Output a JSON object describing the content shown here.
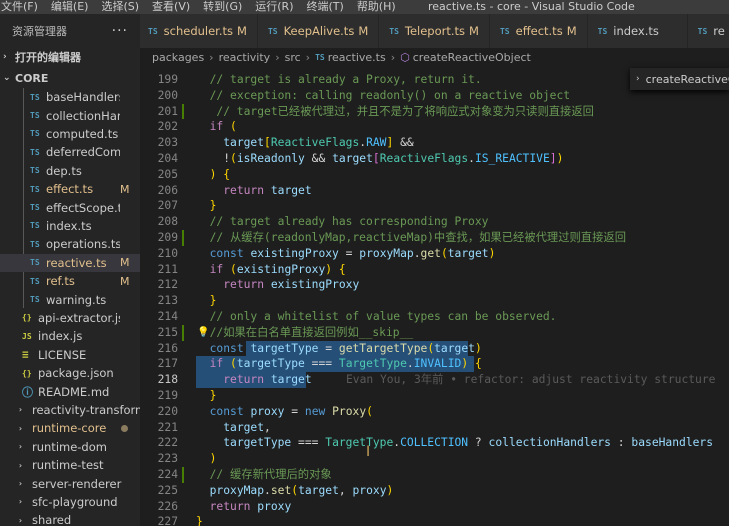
{
  "menu": [
    "文件(F)",
    "编辑(E)",
    "选择(S)",
    "查看(V)",
    "转到(G)",
    "运行(R)",
    "终端(T)",
    "帮助(H)"
  ],
  "window_title": "reactive.ts - core - Visual Studio Code",
  "sidebar": {
    "header": "资源管理器",
    "more": "···",
    "open_editors": "打开的编辑器",
    "root": "CORE",
    "files": [
      {
        "icon": "TS",
        "name": "baseHandlers.ts",
        "badge": ""
      },
      {
        "icon": "TS",
        "name": "collectionHandler...",
        "badge": ""
      },
      {
        "icon": "TS",
        "name": "computed.ts",
        "badge": ""
      },
      {
        "icon": "TS",
        "name": "deferredCompute...",
        "badge": ""
      },
      {
        "icon": "TS",
        "name": "dep.ts",
        "badge": ""
      },
      {
        "icon": "TS",
        "name": "effect.ts",
        "badge": "M"
      },
      {
        "icon": "TS",
        "name": "effectScope.ts",
        "badge": ""
      },
      {
        "icon": "TS",
        "name": "index.ts",
        "badge": ""
      },
      {
        "icon": "TS",
        "name": "operations.ts",
        "badge": ""
      },
      {
        "icon": "TS",
        "name": "reactive.ts",
        "badge": "M"
      },
      {
        "icon": "TS",
        "name": "ref.ts",
        "badge": "M"
      },
      {
        "icon": "TS",
        "name": "warning.ts",
        "badge": ""
      },
      {
        "icon": "{}",
        "name": "api-extractor.json",
        "badge": ""
      },
      {
        "icon": "JS",
        "name": "index.js",
        "badge": ""
      },
      {
        "icon": "≡",
        "name": "LICENSE",
        "badge": ""
      },
      {
        "icon": "{}",
        "name": "package.json",
        "badge": ""
      },
      {
        "icon": "ⓘ",
        "name": "README.md",
        "badge": ""
      }
    ],
    "folders": [
      "reactivity-transform",
      "runtime-core",
      "runtime-dom",
      "runtime-test",
      "server-renderer",
      "sfc-playground",
      "shared"
    ]
  },
  "tabs": [
    {
      "icon": "TS",
      "label": "scheduler.ts",
      "badge": "M"
    },
    {
      "icon": "TS",
      "label": "KeepAlive.ts",
      "badge": "M"
    },
    {
      "icon": "TS",
      "label": "Teleport.ts",
      "badge": "M"
    },
    {
      "icon": "TS",
      "label": "effect.ts",
      "badge": "M"
    },
    {
      "icon": "TS",
      "label": "index.ts",
      "badge": ""
    },
    {
      "icon": "TS",
      "label": "re",
      "badge": ""
    }
  ],
  "breadcrumb": [
    "packages",
    "reactivity",
    "src",
    "reactive.ts",
    "createReactiveObject"
  ],
  "sticky_scroll": "createReactiveOb",
  "code_lines": [
    {
      "n": "199",
      "text": "  // target is already a Proxy, return it."
    },
    {
      "n": "200",
      "text": "  // exception: calling readonly() on a reactive object"
    },
    {
      "n": "201",
      "text": "   // target已经被代理过，并且不是为了将响应式对象变为只读则直接返回"
    },
    {
      "n": "202",
      "text": "  if ("
    },
    {
      "n": "203",
      "text": "    target[ReactiveFlags.RAW] &&"
    },
    {
      "n": "204",
      "text": "    !(isReadonly && target[ReactiveFlags.IS_REACTIVE])"
    },
    {
      "n": "205",
      "text": "  ) {"
    },
    {
      "n": "206",
      "text": "    return target"
    },
    {
      "n": "207",
      "text": "  }"
    },
    {
      "n": "208",
      "text": "  // target already has corresponding Proxy"
    },
    {
      "n": "209",
      "text": "  // 从缓存(readonlyMap,reactiveMap)中查找，如果已经被代理过则直接返回"
    },
    {
      "n": "210",
      "text": "  const existingProxy = proxyMap.get(target)"
    },
    {
      "n": "211",
      "text": "  if (existingProxy) {"
    },
    {
      "n": "212",
      "text": "    return existingProxy"
    },
    {
      "n": "213",
      "text": "  }"
    },
    {
      "n": "214",
      "text": "  // only a whitelist of value types can be observed."
    },
    {
      "n": "215",
      "text": "  //如果在白名单直接返回例如__skip__"
    },
    {
      "n": "216",
      "text": "  const targetType = getTargetType(target)"
    },
    {
      "n": "217",
      "text": "  if (targetType === TargetType.INVALID) {"
    },
    {
      "n": "218",
      "text": "    return target"
    },
    {
      "n": "219",
      "text": "  }"
    },
    {
      "n": "220",
      "text": "  const proxy = new Proxy("
    },
    {
      "n": "221",
      "text": "    target,"
    },
    {
      "n": "222",
      "text": "    targetType === TargetType.COLLECTION ? collectionHandlers : baseHandlers"
    },
    {
      "n": "223",
      "text": "  )"
    },
    {
      "n": "224",
      "text": "  // 缓存新代理后的对象"
    },
    {
      "n": "225",
      "text": "  proxyMap.set(target, proxy)"
    },
    {
      "n": "226",
      "text": "  return proxy"
    },
    {
      "n": "227",
      "text": "}"
    }
  ],
  "blame": "Evan You, 3年前 • refactor: adjust reactivity structure",
  "colors": {
    "editor_bg": "#1e1e1e",
    "sidebar_bg": "#252526",
    "selection": "#264f78",
    "modified": "#e2c08d",
    "comment": "#6a9955",
    "keyword": "#569cd6"
  }
}
